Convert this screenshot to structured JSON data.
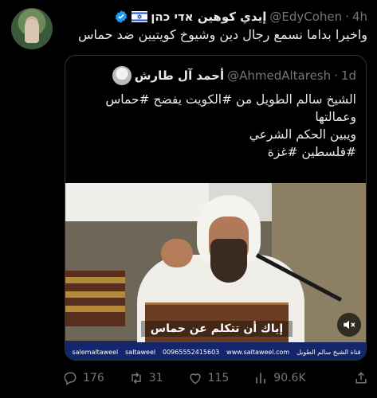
{
  "tweet": {
    "author_name": "إيدي كوهين אדי כהן",
    "handle": "@EdyCohen",
    "separator": "·",
    "time": "4h",
    "text": "واخيرا بداما نسمع رجال دين وشيوخ كويتيين ضد حماس",
    "flag": "israel-flag-icon"
  },
  "quote": {
    "author_name": "أحمد آل طارش",
    "handle": "@AhmedAltaresh",
    "separator": "·",
    "time": "1d",
    "lines": [
      "الشيخ سالم الطويل من #الكويت يفضح #حماس",
      "وعمالتها",
      "ويبين الحكم الشرعي",
      "#فلسطين #غزة"
    ],
    "video": {
      "caption": "إياك أن تتكلم عن حماس",
      "banner_items": [
        "salemaltaweel",
        "saltaweel",
        "00965552415603",
        "www.saltaweel.com",
        "قناة الشيخ سالم الطويل"
      ]
    }
  },
  "actions": {
    "replies": "176",
    "reposts": "31",
    "likes": "115",
    "views": "90.6K"
  },
  "colors": {
    "background": "#000000",
    "text": "#e7e9ea",
    "muted": "#71767b",
    "verified": "#1d9bf0",
    "banner": "#13256b"
  }
}
